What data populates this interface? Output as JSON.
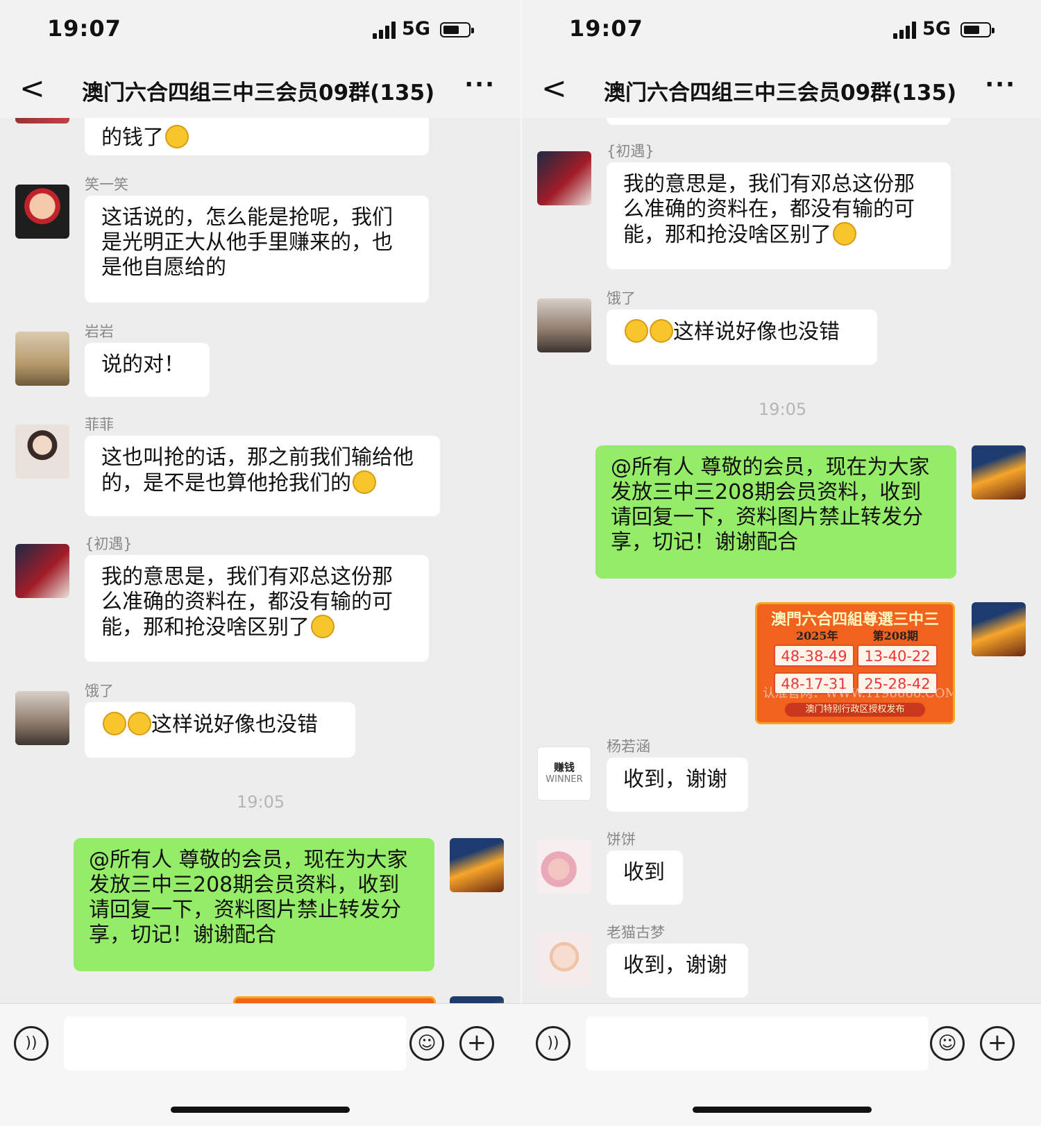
{
  "status": {
    "time": "19:07",
    "network": "5G"
  },
  "header": {
    "title": "澳门六合四组三中三会员09群(135)",
    "back": "<",
    "more": "···"
  },
  "left": {
    "partial_text": "的钱了",
    "messages": [
      {
        "sender": "笑一笑",
        "text": "这话说的，怎么能是抢呢，我们是光明正大从他手里赚来的，也是他自愿给的"
      },
      {
        "sender": "岩岩",
        "text": "说的对！"
      },
      {
        "sender": "菲菲",
        "text": "这也叫抢的话，那之前我们输给他的，是不是也算他抢我们的"
      },
      {
        "sender": "{初遇}",
        "text": "我的意思是，我们有邓总这份那么准确的资料在，都没有输的可能，那和抢没啥区别了"
      },
      {
        "sender": "饿了",
        "text": "这样说好像也没错"
      }
    ],
    "timestamp": "19:05",
    "own_message": "@所有人  尊敬的会员，现在为大家发放三中三208期会员资料，收到请回复一下，资料图片禁止转发分享，切记！谢谢配合"
  },
  "right": {
    "messages_top": [
      {
        "sender": "{初遇}",
        "text": "我的意思是，我们有邓总这份那么准确的资料在，都没有输的可能，那和抢没啥区别了"
      },
      {
        "sender": "饿了",
        "text": "这样说好像也没错"
      }
    ],
    "timestamp": "19:05",
    "own_message": "@所有人  尊敬的会员，现在为大家发放三中三208期会员资料，收到请回复一下，资料图片禁止转发分享，切记！谢谢配合",
    "poster": {
      "title": "澳門六合四組尊選三中三",
      "year": "2025年",
      "issue": "第208期",
      "numbers": [
        "48-38-49",
        "13-40-22",
        "48-17-31",
        "25-28-42"
      ],
      "watermark": "认准官网：WWW.1196666.COM",
      "footer": "澳门特别行政区授权发布"
    },
    "messages_bottom": [
      {
        "sender": "杨若涵",
        "text": "收到，谢谢",
        "avatar_text": [
          "赚钱",
          "WINNER"
        ]
      },
      {
        "sender": "饼饼",
        "text": "收到"
      },
      {
        "sender": "老猫古梦",
        "text": "收到，谢谢"
      }
    ]
  },
  "colors": {
    "own_bubble": "#95ec69",
    "other_bubble": "#ffffff",
    "background": "#ededed"
  },
  "icons": [
    "back-arrow-icon",
    "more-icon",
    "signal-icon",
    "battery-icon",
    "voice-icon",
    "emoji-icon",
    "plus-icon"
  ]
}
